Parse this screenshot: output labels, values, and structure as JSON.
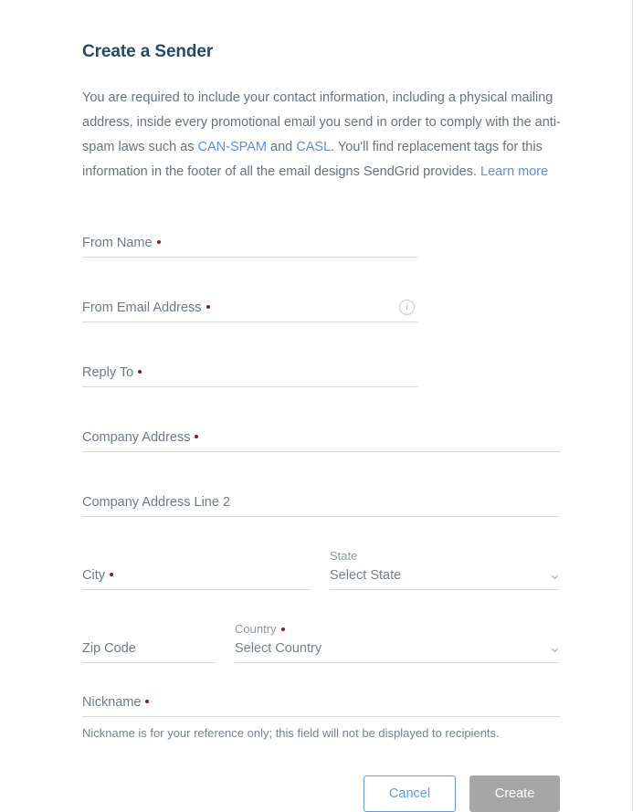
{
  "page": {
    "title": "Create a Sender",
    "intro": {
      "part1": "You are required to include your contact information, including a physical mailing address, inside every promotional email you send in order to comply with the anti-spam laws such as ",
      "link_canspam": "CAN-SPAM",
      "part2": " and ",
      "link_casl": "CASL",
      "part3": ". You'll find replacement tags for this information in the footer of all the email designs SendGrid provides. ",
      "link_learnmore": "Learn more"
    }
  },
  "form": {
    "from_name": {
      "label": "From Name",
      "value": "",
      "required": true
    },
    "from_email": {
      "label": "From Email Address",
      "value": "",
      "required": true,
      "info_icon": "info-icon"
    },
    "reply_to": {
      "label": "Reply To",
      "value": "",
      "required": true
    },
    "company_address": {
      "label": "Company Address",
      "value": "",
      "required": true
    },
    "company_address_2": {
      "label": "Company Address Line 2",
      "value": "",
      "required": false
    },
    "city": {
      "label": "City",
      "value": "",
      "required": true
    },
    "state": {
      "label": "State",
      "value": "Select State",
      "required": false,
      "chevron": "chevron-down-icon"
    },
    "zip_code": {
      "label": "Zip Code",
      "value": "",
      "required": false
    },
    "country": {
      "label": "Country",
      "value": "Select Country",
      "required": true,
      "chevron": "chevron-down-icon"
    },
    "nickname": {
      "label": "Nickname",
      "value": "",
      "required": true
    },
    "nickname_helper": "Nickname is for your reference only; this field will not be displayed to recipients."
  },
  "actions": {
    "cancel_label": "Cancel",
    "create_label": "Create"
  },
  "colors": {
    "title": "#24496b",
    "body_text": "#68737d",
    "link": "#5b8def",
    "required_dot": "#8c2018",
    "underline": "#d8d8d8",
    "cancel_border": "#5b9bf0",
    "create_bg": "#a6a6a6"
  }
}
